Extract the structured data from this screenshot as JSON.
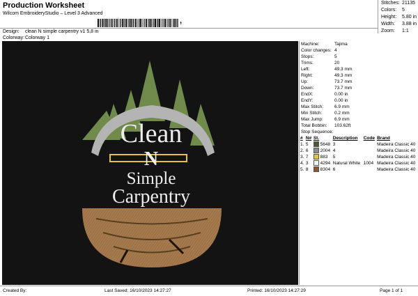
{
  "header": {
    "title": "Production Worksheet",
    "subtitle": "Wilcom EmbroideryStudio – Level 3 Advanced",
    "barcode_suffix": ",",
    "design_label": "Design:",
    "design_value": "clean N simple carpentry v1 5,8 in",
    "colorway_label": "Colorway:",
    "colorway_value": "Colorway 1"
  },
  "stats": [
    {
      "k": "Stitches:",
      "v": "21135"
    },
    {
      "k": "Colors:",
      "v": "5"
    },
    {
      "k": "Height:",
      "v": "5.80 in"
    },
    {
      "k": "Width:",
      "v": "3.88 in"
    },
    {
      "k": "Zoom:",
      "v": "1:1"
    }
  ],
  "design": {
    "line1": "Clean",
    "line2": "N",
    "line3": "Simple",
    "line4": "Carpentry",
    "colors": {
      "tree": "#6f8a4a",
      "saw": "#b4b4b4",
      "text": "#ededed",
      "wood": "#a57a4e",
      "ruler": "#e6c23a"
    }
  },
  "info": [
    {
      "k": "Machine:",
      "v": "Tajima"
    },
    {
      "k": "Color changes:",
      "v": "4"
    },
    {
      "k": "Stops:",
      "v": "5"
    },
    {
      "k": "Trims:",
      "v": "20"
    },
    {
      "k": "Left:",
      "v": "49.3 mm"
    },
    {
      "k": "Right:",
      "v": "49.3 mm"
    },
    {
      "k": "Up:",
      "v": "73.7 mm"
    },
    {
      "k": "Down:",
      "v": "73.7 mm"
    },
    {
      "k": "EndX:",
      "v": "0.00 in"
    },
    {
      "k": "EndY:",
      "v": "0.00 in"
    },
    {
      "k": "Max Stitch:",
      "v": "6.9 mm"
    },
    {
      "k": "Min Stitch:",
      "v": "0.2 mm"
    },
    {
      "k": "Max Jump:",
      "v": "6.9 mm"
    },
    {
      "k": "Total Bobbin:",
      "v": "103.62ft"
    }
  ],
  "sequence": {
    "title": "Stop Sequence:",
    "headers": [
      "#",
      "N#",
      "St.",
      "Description",
      "Code",
      "Brand"
    ],
    "rows": [
      {
        "n": "1.",
        "num": "5",
        "color": "#4a5a2e",
        "st": "5648",
        "desc": "3",
        "code": "",
        "brand": "Madeira Classic 40"
      },
      {
        "n": "2.",
        "num": "6",
        "color": "#8c8c8c",
        "st": "2004",
        "desc": "4",
        "code": "",
        "brand": "Madeira Classic 40"
      },
      {
        "n": "3.",
        "num": "7",
        "color": "#e8c040",
        "st": "883",
        "desc": "5",
        "code": "",
        "brand": "Madeira Classic 40"
      },
      {
        "n": "4.",
        "num": "3",
        "color": "#f2f2f2",
        "st": "4294",
        "desc": "Natural White",
        "code": "1004",
        "brand": "Madeira Classic 40"
      },
      {
        "n": "5.",
        "num": "8",
        "color": "#8a5530",
        "st": "8304",
        "desc": "6",
        "code": "",
        "brand": "Madeira Classic 40"
      }
    ]
  },
  "footer": {
    "created": "Created By:",
    "saved": "Last Saved: 16/10/2023 14:27:27",
    "printed": "Printed: 16/10/2023 14:27:29",
    "page": "Page 1 of 1"
  }
}
